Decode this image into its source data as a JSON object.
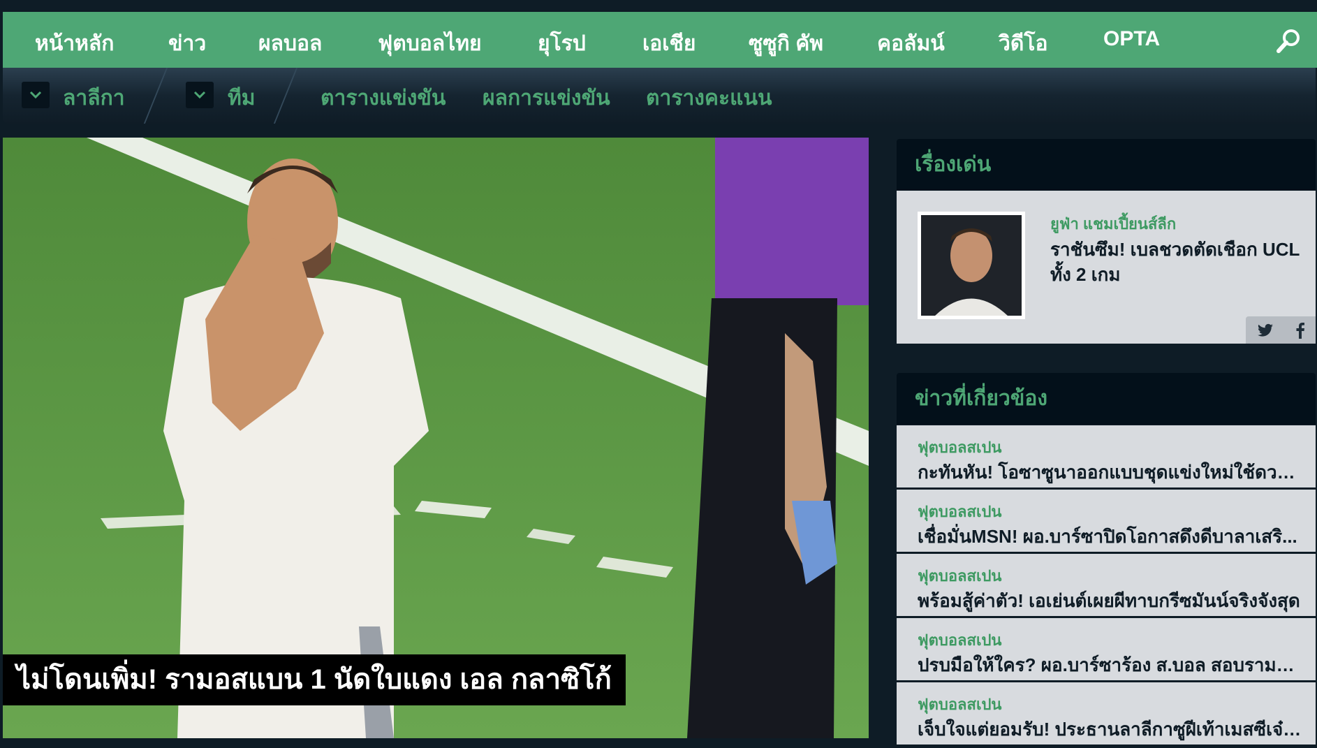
{
  "top_nav": {
    "items": [
      "หน้าหลัก",
      "ข่าว",
      "ผลบอล",
      "ฟุตบอลไทย",
      "ยุโรป",
      "เอเชีย",
      "ซูซูกิ คัพ",
      "คอลัมน์",
      "วิดีโอ",
      "OPTA"
    ],
    "search_icon": "search-icon"
  },
  "sub_nav": {
    "league_label": "ลาลีกา",
    "team_label": "ทีม",
    "fixtures_label": "ตารางแข่งขัน",
    "results_label": "ผลการแข่งขัน",
    "standings_label": "ตารางคะแนน"
  },
  "hero": {
    "caption": "ไม่โดนเพิ่ม! รามอสแบน 1 นัดใบแดง เอล กลาซิโก้"
  },
  "featured": {
    "heading": "เรื่องเด่น",
    "category": "ยูฟ่า แชมเปี้ยนส์ลีก",
    "title": "ราชันซึม! เบลชวดตัดเชือก UCL ทั้ง 2 เกม"
  },
  "related": {
    "heading": "ข่าวที่เกี่ยวข้อง",
    "items": [
      {
        "category": "ฟุตบอลสเปน",
        "title": "กะทันหัน! โอซาซูนาออกแบบชุดแข่งใหม่ใช้ดวล..."
      },
      {
        "category": "ฟุตบอลสเปน",
        "title": "เชื่อมั่นMSN! ผอ.บาร์ซาปิดโอกาสดึงดีบาลาเสริ..."
      },
      {
        "category": "ฟุตบอลสเปน",
        "title": "พร้อมสู้ค่าตัว! เอเย่นต์เผยผีทาบกรีซมันน์จริงจังสุด"
      },
      {
        "category": "ฟุตบอลสเปน",
        "title": "ปรบมือให้ใคร? ผอ.บาร์ซาร้อง ส.บอล สอบรามอ..."
      },
      {
        "category": "ฟุตบอลสเปน",
        "title": "เจ็บใจแต่ยอมรับ! ประธานลาลีกาซูฝีเท้าเมสซีเจ๋ง..."
      }
    ]
  },
  "colors": {
    "nav_green": "#4ea775",
    "background": "#0e1c26",
    "panel_head": "#03101a",
    "card_bg": "#d8dbdf"
  }
}
